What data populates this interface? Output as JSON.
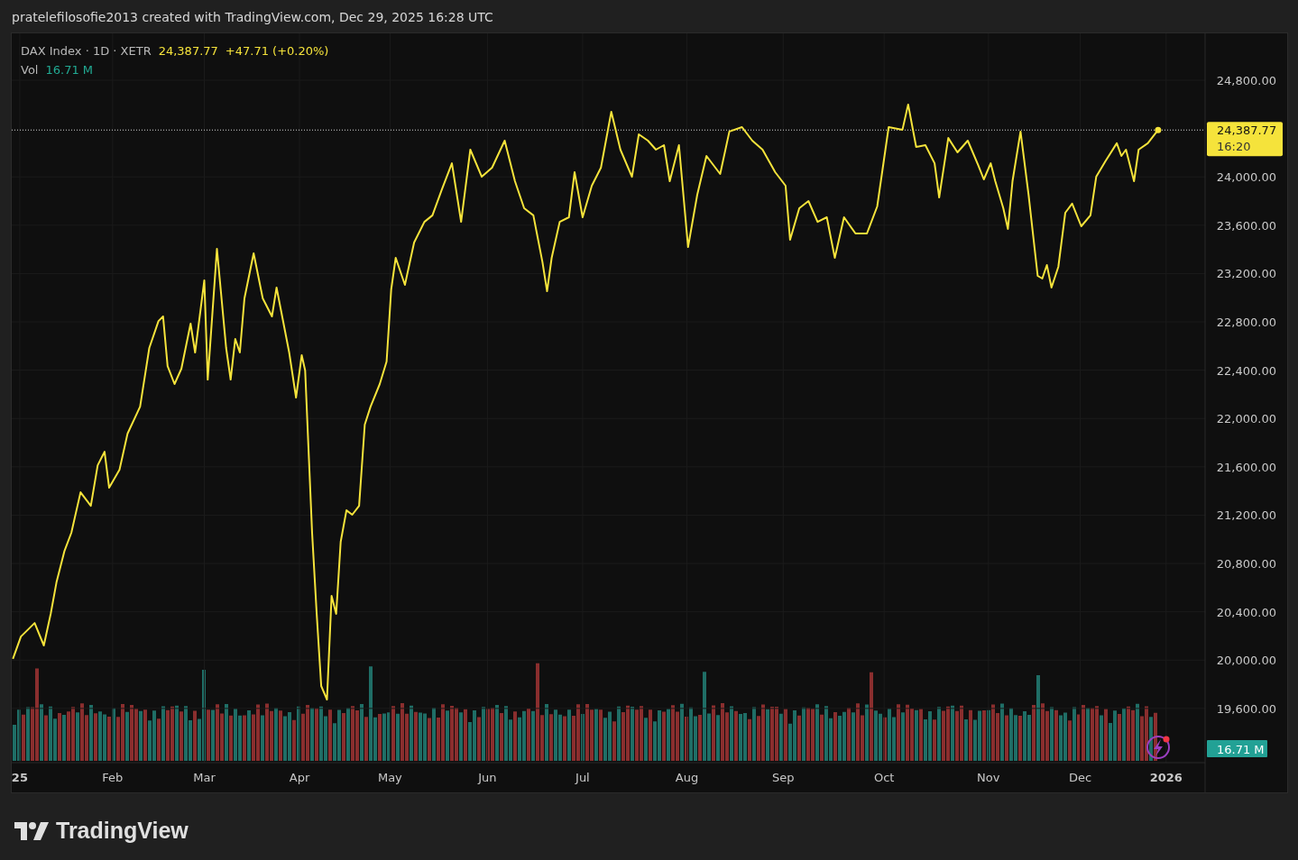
{
  "caption": "pratelefilosofie2013 created with TradingView.com, Dec 29, 2025 16:28 UTC",
  "legend": {
    "symbol": "DAX Index · 1D · XETR",
    "price": "24,387.77",
    "change": "+47.71 (+0.20%)",
    "volume_label": "Vol",
    "volume": "16.71 M"
  },
  "chart": {
    "price_badge": {
      "price": "24,387.77",
      "time": "16:20"
    },
    "volume_badge": "16.71 M",
    "chart_data": {
      "type": "line",
      "x": [
        2024.994,
        2025.001,
        2025.013,
        2025.021,
        2025.027,
        2025.032,
        2025.039,
        2025.045,
        2025.053,
        2025.062,
        2025.068,
        2025.074,
        2025.078,
        2025.087,
        2025.094,
        2025.105,
        2025.113,
        2025.121,
        2025.125,
        2025.129,
        2025.135,
        2025.141,
        2025.149,
        2025.153,
        2025.161,
        2025.164,
        2025.172,
        2025.18,
        2025.184,
        2025.188,
        2025.192,
        2025.196,
        2025.204,
        2025.212,
        2025.22,
        2025.224,
        2025.235,
        2025.241,
        2025.246,
        2025.249,
        2025.255,
        2025.259,
        2025.263,
        2025.268,
        2025.272,
        2025.276,
        2025.28,
        2025.285,
        2025.29,
        2025.296,
        2025.301,
        2025.306,
        2025.314,
        2025.32,
        2025.324,
        2025.328,
        2025.336,
        2025.344,
        2025.353,
        2025.36,
        2025.368,
        2025.377,
        2025.385,
        2025.393,
        2025.403,
        2025.412,
        2025.423,
        2025.432,
        2025.44,
        2025.448,
        2025.456,
        2025.46,
        2025.464,
        2025.471,
        2025.479,
        2025.484,
        2025.491,
        2025.499,
        2025.507,
        2025.516,
        2025.524,
        2025.534,
        2025.54,
        2025.548,
        2025.555,
        2025.562,
        2025.567,
        2025.575,
        2025.583,
        2025.591,
        2025.599,
        2025.611,
        2025.619,
        2025.63,
        2025.639,
        2025.648,
        2025.659,
        2025.668,
        2025.672,
        2025.68,
        2025.688,
        2025.696,
        2025.704,
        2025.711,
        2025.719,
        2025.729,
        2025.739,
        2025.748,
        2025.758,
        2025.77,
        2025.775,
        2025.782,
        2025.79,
        2025.798,
        2025.802,
        2025.81,
        2025.818,
        2025.827,
        2025.836,
        2025.841,
        2025.847,
        2025.851,
        2025.858,
        2025.862,
        2025.866,
        2025.873,
        2025.88,
        2025.888,
        2025.892,
        2025.896,
        2025.9,
        2025.906,
        2025.912,
        2025.918,
        2025.926,
        2025.934,
        2025.939,
        2025.947,
        2025.957,
        2025.961,
        2025.965,
        2025.972,
        2025.976,
        2025.984,
        2025.993
      ],
      "series": [
        {
          "color": "#f5e33b",
          "values": [
            20010,
            20195,
            20307,
            20121,
            20382,
            20643,
            20904,
            21054,
            21389,
            21277,
            21613,
            21725,
            21427,
            21576,
            21875,
            22098,
            22584,
            22807,
            22845,
            22434,
            22285,
            22412,
            22785,
            22546,
            23143,
            22322,
            23404,
            22584,
            22322,
            22658,
            22546,
            22994,
            23367,
            22994,
            22845,
            23084,
            22546,
            22173,
            22524,
            22397,
            21054,
            20382,
            19785,
            19673,
            20531,
            20382,
            20979,
            21240,
            21203,
            21277,
            21949,
            22098,
            22285,
            22472,
            23069,
            23330,
            23106,
            23457,
            23628,
            23681,
            23890,
            24113,
            23628,
            24225,
            24001,
            24076,
            24300,
            23964,
            23740,
            23681,
            23293,
            23054,
            23330,
            23628,
            23666,
            24039,
            23666,
            23927,
            24076,
            24539,
            24225,
            24001,
            24352,
            24300,
            24225,
            24263,
            23964,
            24263,
            23419,
            23852,
            24173,
            24024,
            24375,
            24412,
            24300,
            24225,
            24039,
            23927,
            23479,
            23740,
            23800,
            23628,
            23666,
            23330,
            23666,
            23531,
            23531,
            23755,
            24412,
            24390,
            24599,
            24248,
            24263,
            24113,
            23830,
            24322,
            24203,
            24300,
            24098,
            23979,
            24113,
            23964,
            23740,
            23569,
            23964,
            24375,
            23852,
            23181,
            23158,
            23270,
            23084,
            23255,
            23703,
            23778,
            23591,
            23681,
            24001,
            24128,
            24278,
            24173,
            24225,
            23964,
            24225,
            24278,
            24388
          ]
        }
      ],
      "xlim": [
        2024.993,
        2026.034
      ],
      "ylim": [
        19151,
        25188
      ],
      "grid": true,
      "ref_lines": [
        {
          "axis": "y",
          "value": 24387.77
        }
      ],
      "xticks": [
        {
          "value": 2025,
          "label": "25"
        },
        {
          "value": 2025.081,
          "label": "Feb"
        },
        {
          "value": 2025.161,
          "label": "Mar"
        },
        {
          "value": 2025.244,
          "label": "Apr"
        },
        {
          "value": 2025.323,
          "label": "May"
        },
        {
          "value": 2025.408,
          "label": "Jun"
        },
        {
          "value": 2025.491,
          "label": "Jul"
        },
        {
          "value": 2025.582,
          "label": "Aug"
        },
        {
          "value": 2025.666,
          "label": "Sep"
        },
        {
          "value": 2025.754,
          "label": "Oct"
        },
        {
          "value": 2025.845,
          "label": "Nov"
        },
        {
          "value": 2025.925,
          "label": "Dec"
        },
        {
          "value": 2026,
          "label": "2026"
        }
      ],
      "yticks": [
        {
          "value": 24800,
          "label": "24,800.00"
        },
        {
          "value": 24000,
          "label": "24,000.00"
        },
        {
          "value": 23600,
          "label": "23,600.00"
        },
        {
          "value": 23200,
          "label": "23,200.00"
        },
        {
          "value": 22800,
          "label": "22,800.00"
        },
        {
          "value": 22400,
          "label": "22,400.00"
        },
        {
          "value": 22000,
          "label": "22,000.00"
        },
        {
          "value": 21600,
          "label": "21,600.00"
        },
        {
          "value": 21200,
          "label": "21,200.00"
        },
        {
          "value": 20800,
          "label": "20,800.00"
        },
        {
          "value": 20400,
          "label": "20,400.00"
        },
        {
          "value": 20000,
          "label": "20,000.00"
        },
        {
          "value": 19600,
          "label": "19,600.00"
        }
      ]
    }
  },
  "logo": "TradingView"
}
